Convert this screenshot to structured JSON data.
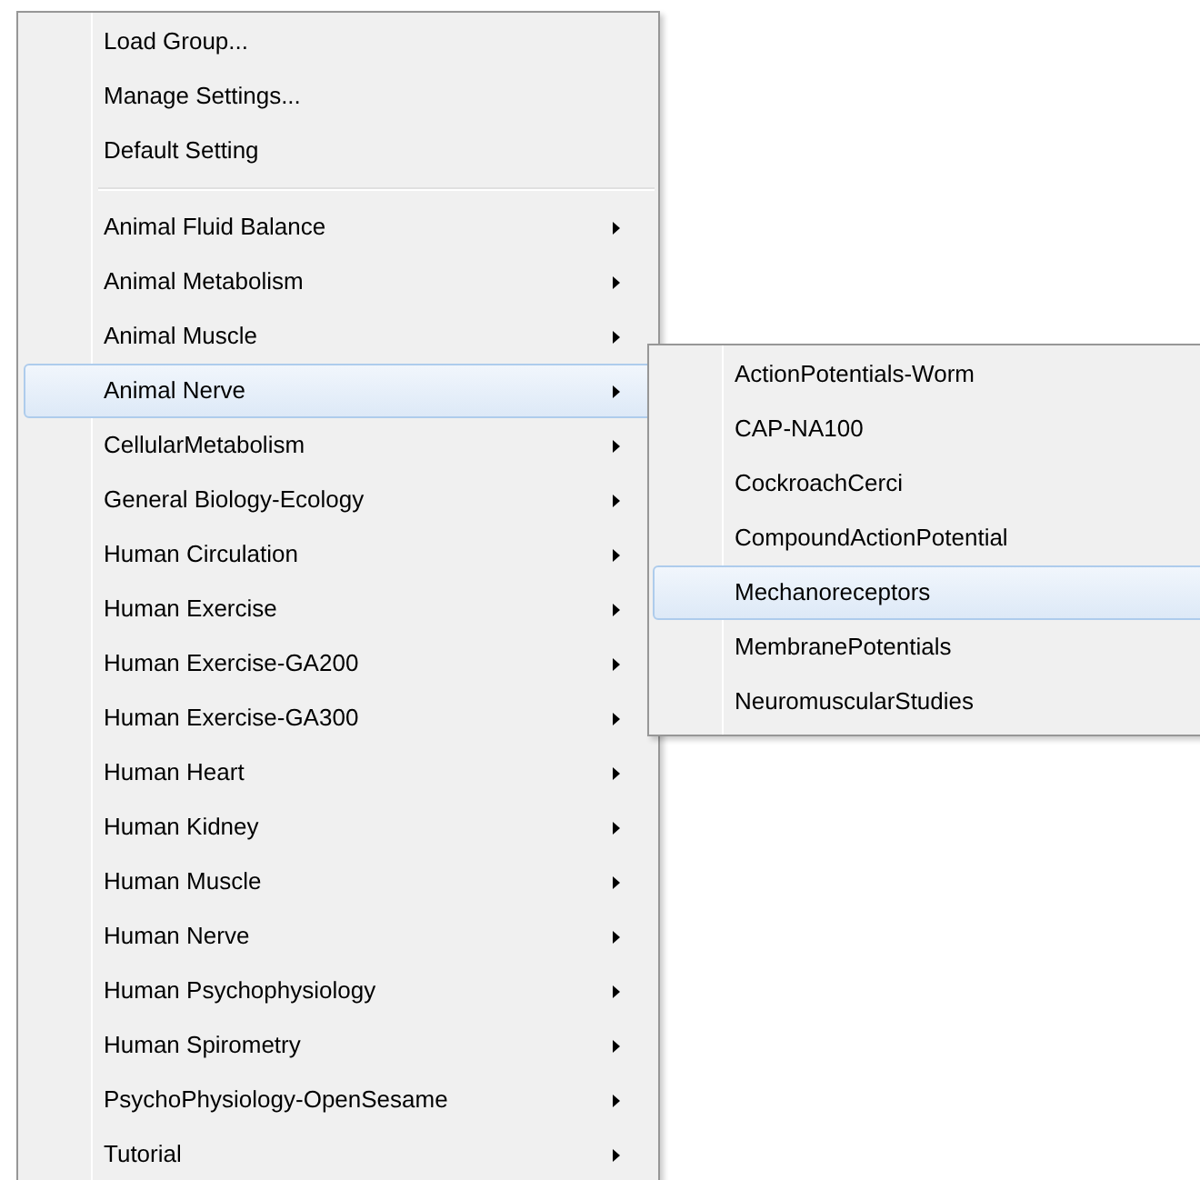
{
  "menu": {
    "sections": [
      {
        "items": [
          {
            "label": "Load Group...",
            "kind": "command",
            "selected": false
          },
          {
            "label": "Manage Settings...",
            "kind": "command",
            "selected": false
          },
          {
            "label": "Default Setting",
            "kind": "command",
            "selected": false
          }
        ]
      },
      {
        "items": [
          {
            "label": "Animal Fluid Balance",
            "kind": "submenu",
            "selected": false
          },
          {
            "label": "Animal Metabolism",
            "kind": "submenu",
            "selected": false
          },
          {
            "label": "Animal Muscle",
            "kind": "submenu",
            "selected": false
          },
          {
            "label": "Animal Nerve",
            "kind": "submenu",
            "selected": true,
            "children": [
              {
                "label": "ActionPotentials-Worm",
                "selected": false
              },
              {
                "label": "CAP-NA100",
                "selected": false
              },
              {
                "label": "CockroachCerci",
                "selected": false
              },
              {
                "label": "CompoundActionPotential",
                "selected": false
              },
              {
                "label": "Mechanoreceptors",
                "selected": true
              },
              {
                "label": "MembranePotentials",
                "selected": false
              },
              {
                "label": "NeuromuscularStudies",
                "selected": false
              }
            ]
          },
          {
            "label": "CellularMetabolism",
            "kind": "submenu",
            "selected": false
          },
          {
            "label": "General Biology-Ecology",
            "kind": "submenu",
            "selected": false
          },
          {
            "label": "Human Circulation",
            "kind": "submenu",
            "selected": false
          },
          {
            "label": "Human Exercise",
            "kind": "submenu",
            "selected": false
          },
          {
            "label": "Human Exercise-GA200",
            "kind": "submenu",
            "selected": false
          },
          {
            "label": "Human Exercise-GA300",
            "kind": "submenu",
            "selected": false
          },
          {
            "label": "Human Heart",
            "kind": "submenu",
            "selected": false
          },
          {
            "label": "Human Kidney",
            "kind": "submenu",
            "selected": false
          },
          {
            "label": "Human Muscle",
            "kind": "submenu",
            "selected": false
          },
          {
            "label": "Human Nerve",
            "kind": "submenu",
            "selected": false
          },
          {
            "label": "Human Psychophysiology",
            "kind": "submenu",
            "selected": false
          },
          {
            "label": "Human Spirometry",
            "kind": "submenu",
            "selected": false
          },
          {
            "label": "PsychoPhysiology-OpenSesame",
            "kind": "submenu",
            "selected": false
          },
          {
            "label": "Tutorial",
            "kind": "submenu",
            "selected": false
          }
        ]
      }
    ]
  }
}
